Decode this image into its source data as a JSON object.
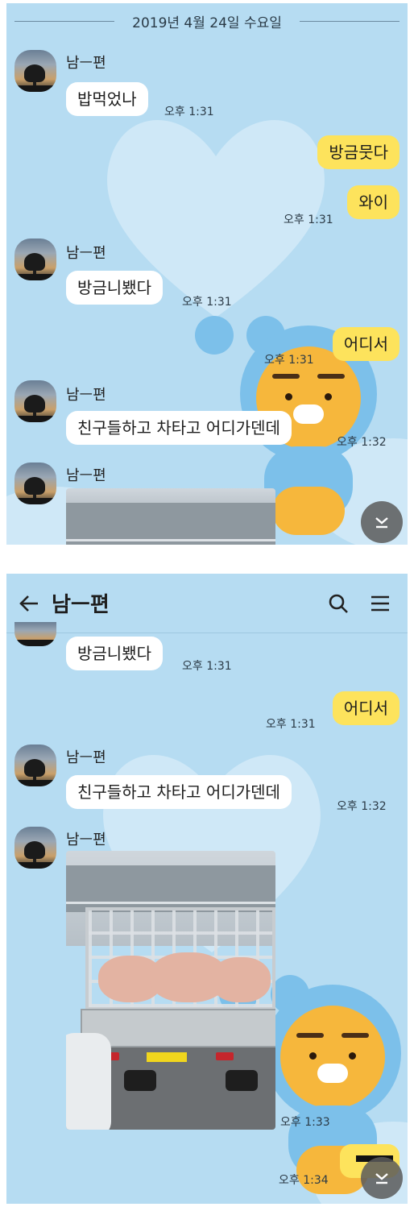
{
  "screen1": {
    "date_divider": "2019년 4월 24일 수요일",
    "messages": [
      {
        "sender": "남ㅡ편",
        "text": "밥먹었나",
        "time": "오후 1:31"
      },
      {
        "text": "방금뭇다"
      },
      {
        "text": "와이",
        "time": "오후 1:31"
      },
      {
        "sender": "남ㅡ편",
        "text": "방금니뵀다",
        "time": "오후 1:31"
      },
      {
        "text": "어디서",
        "time": "오후 1:31"
      },
      {
        "sender": "남ㅡ편",
        "text": "친구들하고 차타고 어디가덴데",
        "time": "오후 1:32"
      },
      {
        "sender": "남ㅡ편"
      }
    ]
  },
  "screen2": {
    "header": {
      "title": "남ㅡ편"
    },
    "messages": [
      {
        "text": "방금니뵀다",
        "time": "오후 1:31"
      },
      {
        "text": "어디서",
        "time": "오후 1:31"
      },
      {
        "sender": "남ㅡ편",
        "text": "친구들하고 차타고 어디가덴데",
        "time": "오후 1:32"
      },
      {
        "sender": "남ㅡ편",
        "time": "오후 1:33"
      },
      {
        "time": "오후 1:34"
      }
    ]
  },
  "icons": {
    "back": "back-arrow-icon",
    "search": "search-icon",
    "menu": "hamburger-menu-icon",
    "scroll_down": "scroll-down-icon"
  },
  "colors": {
    "chat_background": "#b6dcf2",
    "outgoing_bubble": "#fde35c",
    "incoming_bubble": "#ffffff"
  }
}
